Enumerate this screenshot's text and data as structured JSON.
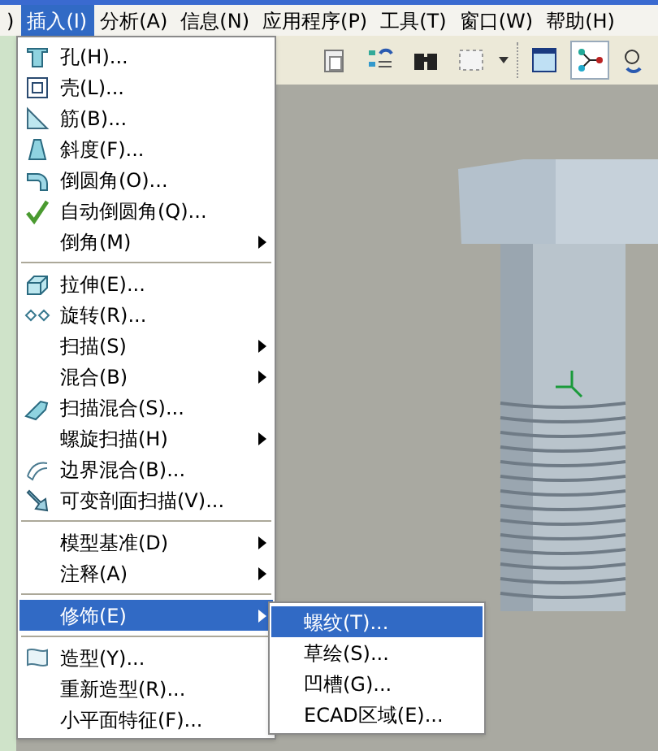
{
  "menubar": [
    {
      "label": ")",
      "selected": false
    },
    {
      "label": "插入(I)",
      "selected": true
    },
    {
      "label": "分析(A)",
      "selected": false
    },
    {
      "label": "信息(N)",
      "selected": false
    },
    {
      "label": "应用程序(P)",
      "selected": false
    },
    {
      "label": "工具(T)",
      "selected": false
    },
    {
      "label": "窗口(W)",
      "selected": false
    },
    {
      "label": "帮助(H)",
      "selected": false
    }
  ],
  "insert_menu": [
    {
      "kind": "item",
      "label": "孔(H)...",
      "submenu": false,
      "selected": false
    },
    {
      "kind": "item",
      "label": "壳(L)...",
      "submenu": false,
      "selected": false
    },
    {
      "kind": "item",
      "label": "筋(B)...",
      "submenu": false,
      "selected": false
    },
    {
      "kind": "item",
      "label": "斜度(F)...",
      "submenu": false,
      "selected": false
    },
    {
      "kind": "item",
      "label": "倒圆角(O)...",
      "submenu": false,
      "selected": false
    },
    {
      "kind": "item",
      "label": "自动倒圆角(Q)...",
      "submenu": false,
      "selected": false
    },
    {
      "kind": "item",
      "label": "倒角(M)",
      "submenu": true,
      "selected": false
    },
    {
      "kind": "separator"
    },
    {
      "kind": "item",
      "label": "拉伸(E)...",
      "submenu": false,
      "selected": false
    },
    {
      "kind": "item",
      "label": "旋转(R)...",
      "submenu": false,
      "selected": false
    },
    {
      "kind": "item",
      "label": "扫描(S)",
      "submenu": true,
      "selected": false
    },
    {
      "kind": "item",
      "label": "混合(B)",
      "submenu": true,
      "selected": false
    },
    {
      "kind": "item",
      "label": "扫描混合(S)...",
      "submenu": false,
      "selected": false
    },
    {
      "kind": "item",
      "label": "螺旋扫描(H)",
      "submenu": true,
      "selected": false
    },
    {
      "kind": "item",
      "label": "边界混合(B)...",
      "submenu": false,
      "selected": false
    },
    {
      "kind": "item",
      "label": "可变剖面扫描(V)...",
      "submenu": false,
      "selected": false
    },
    {
      "kind": "separator"
    },
    {
      "kind": "item",
      "label": "模型基准(D)",
      "submenu": true,
      "selected": false
    },
    {
      "kind": "item",
      "label": "注释(A)",
      "submenu": true,
      "selected": false
    },
    {
      "kind": "separator"
    },
    {
      "kind": "item",
      "label": "修饰(E)",
      "submenu": true,
      "selected": true
    },
    {
      "kind": "separator"
    },
    {
      "kind": "item",
      "label": "造型(Y)...",
      "submenu": false,
      "selected": false
    },
    {
      "kind": "item",
      "label": "重新造型(R)...",
      "submenu": false,
      "selected": false
    },
    {
      "kind": "item",
      "label": "小平面特征(F)...",
      "submenu": false,
      "selected": false
    }
  ],
  "cosmetic_submenu": [
    {
      "label": "螺纹(T)...",
      "selected": true
    },
    {
      "label": "草绘(S)...",
      "selected": false
    },
    {
      "label": "凹槽(G)...",
      "selected": false
    },
    {
      "label": "ECAD区域(E)...",
      "selected": false
    }
  ]
}
